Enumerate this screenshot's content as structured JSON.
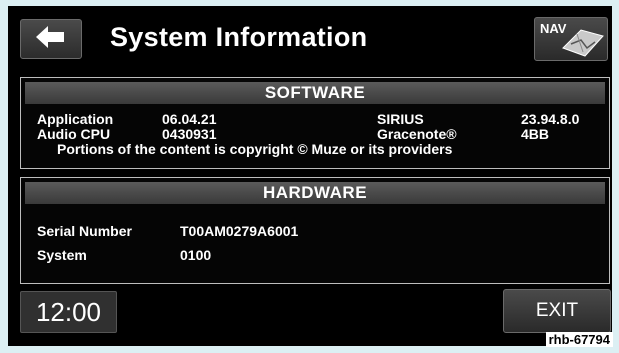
{
  "header": {
    "title": "System Information",
    "nav_label": "NAV"
  },
  "software": {
    "heading": "SOFTWARE",
    "rows": [
      {
        "label": "Application",
        "value": "06.04.21",
        "label2": "SIRIUS",
        "value2": "23.94.8.0"
      },
      {
        "label": "Audio CPU",
        "value": "0430931",
        "label2": "Gracenote®",
        "value2": "4BB"
      }
    ],
    "copyright": "Portions of the content is copyright © Muze or its providers"
  },
  "hardware": {
    "heading": "HARDWARE",
    "rows": [
      {
        "label": "Serial Number",
        "value": "T00AM0279A6001"
      },
      {
        "label": "System",
        "value": "0100"
      }
    ]
  },
  "footer": {
    "clock": "12:00",
    "exit_label": "EXIT",
    "image_code": "rhb-67794"
  },
  "icons": {
    "back": "back-arrow-icon",
    "nav": "map-icon"
  }
}
